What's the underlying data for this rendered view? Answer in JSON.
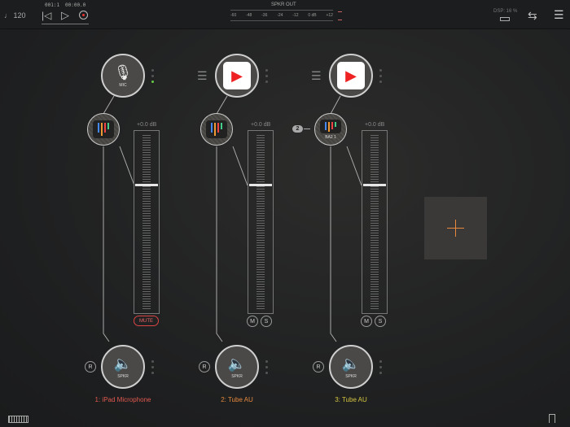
{
  "transport": {
    "tempo": "120",
    "position": "001:1",
    "time": "00:00.0"
  },
  "meter": {
    "title": "SPKR OUT",
    "ticks": [
      "-60",
      "-48",
      "-36",
      "-24",
      "-12",
      "0 dB",
      "+12"
    ]
  },
  "status": {
    "dsp": "DSP: 16 %"
  },
  "channels": [
    {
      "source": "MIC",
      "source_type": "mic",
      "label": "1: iPad Microphone",
      "color": "#e25850",
      "gain": "+0.0 dB",
      "mute": "MUTE",
      "output": "SPKR",
      "rec": "R"
    },
    {
      "source": "",
      "source_type": "app",
      "label": "2: Tube AU",
      "color": "#e8883e",
      "gain": "+0.0 dB",
      "m": "M",
      "s": "S",
      "output": "SPKR",
      "rec": "R"
    },
    {
      "source": "",
      "source_type": "app",
      "label": "3: Tube AU",
      "color": "#d8c640",
      "gain": "+0.0 dB",
      "m": "M",
      "s": "S",
      "output": "SPKR",
      "rec": "R",
      "plugin_label": "BA2 1",
      "badge": "2"
    }
  ],
  "colors": {
    "accent": "#e8883e",
    "record": "#e33"
  }
}
